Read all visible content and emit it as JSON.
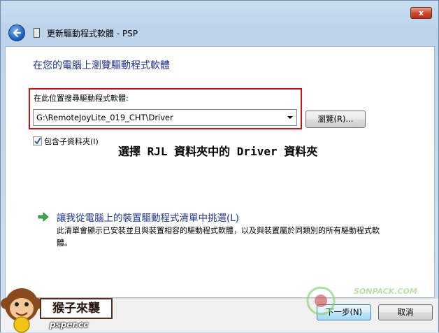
{
  "window": {
    "title": "更新驅動程式軟體 - PSP",
    "close_label": "x"
  },
  "main": {
    "heading": "在您的電腦上瀏覽驅動程式軟體",
    "search_label": "在此位置搜尋驅動程式軟體:",
    "path_value": "G:\\RemoteJoyLite_019_CHT\\Driver",
    "browse_label": "瀏覽(R)...",
    "include_subfolders_label": "包含子資料夾(I)",
    "include_subfolders_checked": true,
    "annotation": "選擇 RJL 資料夾中的 Driver 資料夾",
    "pick_link": "讓我從電腦上的裝置驅動程式清單中挑選(L)",
    "pick_desc": "此清單會顯示已安裝並且與裝置相容的驅動程式軟體，以及與裝置屬於同類別的所有驅動程式軟體。"
  },
  "footer": {
    "next_label": "下一步(N)",
    "cancel_label": "取消"
  },
  "watermarks": {
    "left_label": "猴子來襲",
    "left_url": "psper.cc",
    "right_text": "SONPACK.COM"
  },
  "colors": {
    "heading": "#1e3287",
    "highlight_frame": "#c4161c",
    "link_arrow": "#3aa84a"
  },
  "icons": {
    "back": "back-arrow-icon",
    "title": "device-icon",
    "check": "checkmark-icon",
    "link": "green-arrow-icon",
    "dropdown": "chevron-down-icon"
  }
}
